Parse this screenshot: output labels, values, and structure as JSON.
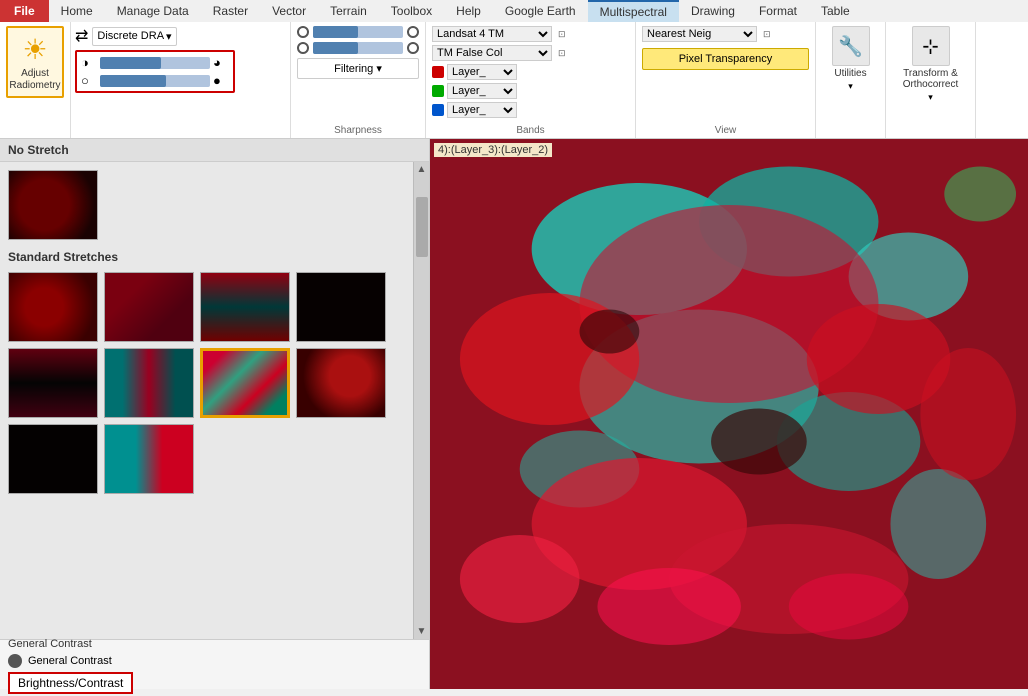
{
  "tabs": [
    {
      "id": "file",
      "label": "File",
      "active": false,
      "style": "file"
    },
    {
      "id": "home",
      "label": "Home",
      "active": false
    },
    {
      "id": "manage-data",
      "label": "Manage Data",
      "active": false
    },
    {
      "id": "raster",
      "label": "Raster",
      "active": false
    },
    {
      "id": "vector",
      "label": "Vector",
      "active": false
    },
    {
      "id": "terrain",
      "label": "Terrain",
      "active": false
    },
    {
      "id": "toolbox",
      "label": "Toolbox",
      "active": false
    },
    {
      "id": "help",
      "label": "Help",
      "active": false
    },
    {
      "id": "google-earth",
      "label": "Google Earth",
      "active": false
    },
    {
      "id": "multispectral",
      "label": "Multispectral",
      "active": true
    },
    {
      "id": "drawing",
      "label": "Drawing",
      "active": false
    },
    {
      "id": "format",
      "label": "Format",
      "active": false
    },
    {
      "id": "table",
      "label": "Table",
      "active": false
    }
  ],
  "ribbon": {
    "adjust_radiometry": "Adjust\nRadiometry",
    "dra_label": "Discrete DRA",
    "filtering_label": "Filtering",
    "sharpness_label": "Sharpness",
    "source_dropdown1": "Landsat 4 TM",
    "source_dropdown2": "TM False Col",
    "bands_label": "Bands",
    "layer1": "Layer_",
    "layer2": "Layer_",
    "layer3": "Layer_",
    "resampling_label": "Nearest Neig",
    "pixel_transparency": "Pixel Transparency",
    "view_label": "View",
    "utilities_label": "Utilities",
    "transform_label": "Transform &\nOrthocorrect"
  },
  "left_panel": {
    "title": "No Stretch",
    "standard_stretches_title": "Standard Stretches",
    "general_contrast_label": "General Contrast",
    "brightness_contrast_label": "Brightness/Contrast"
  },
  "map": {
    "layer_label": "4):(Layer_3):(Layer_2)"
  },
  "thumbs": [
    {
      "id": 0,
      "style": "thumb-dark",
      "selected": false
    },
    {
      "id": 1,
      "style": "thumb-red",
      "selected": false
    },
    {
      "id": 2,
      "style": "thumb-red2",
      "selected": false
    },
    {
      "id": 3,
      "style": "thumb-dark",
      "selected": false
    },
    {
      "id": 4,
      "style": "thumb-black",
      "selected": false
    },
    {
      "id": 5,
      "style": "thumb-mixed",
      "selected": false
    },
    {
      "id": 6,
      "style": "thumb-selected",
      "selected": true
    },
    {
      "id": 7,
      "style": "thumb-red3",
      "selected": false
    },
    {
      "id": 8,
      "style": "thumb-dark2",
      "selected": false
    },
    {
      "id": 9,
      "style": "thumb-cyan-red",
      "selected": false
    }
  ]
}
